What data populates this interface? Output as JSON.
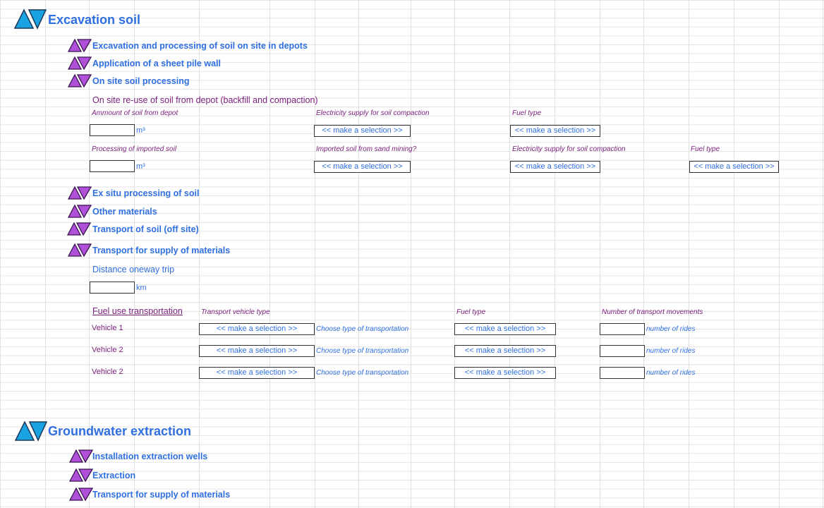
{
  "sections": {
    "excavation": {
      "title": "Excavation soil"
    },
    "groundwater": {
      "title": "Groundwater extraction"
    }
  },
  "excavation_items": {
    "depots": "Excavation and processing of soil on site in depots",
    "sheet_pile": "Application of a sheet pile wall",
    "on_site": "On site soil processing",
    "ex_situ": "Ex situ processing of soil",
    "other": "Other materials",
    "transport_offsite": "Transport of soil (off site)",
    "transport_supply": "Transport for supply of materials"
  },
  "reuse": {
    "heading": "On site re-use of soil from depot (backfill and compaction)",
    "amount_label": "Ammount of soil from depot",
    "electricity_label": "Electricity supply for soil compaction",
    "fuel_label": "Fuel type",
    "processing_label": "Processing of imported soil",
    "sand_mining_label": "Imported soil from sand mining?",
    "electricity_label_2": "Electricity supply for soil compaction",
    "fuel_label_2": "Fuel type",
    "unit_m3": "m³",
    "select_text": "<< make a selection >>"
  },
  "supply": {
    "distance_label": "Distance oneway trip",
    "unit_km": "km",
    "fuel_use_label": "Fuel use transportation",
    "vehicle_type_header": "Transport vehicle type",
    "fuel_type_header": "Fuel type",
    "movements_header": "Number of transport movements",
    "select_text": "<< make a selection >>",
    "type_hint": "Choose type of transportation",
    "rides_hint": "number of rides",
    "vehicles": [
      "Vehicle 1",
      "Vehicle 2",
      "Vehicle 2"
    ]
  },
  "groundwater_items": {
    "wells": "Installation extraction wells",
    "extraction": "Extraction",
    "transport_supply": "Transport for supply of materials"
  },
  "colors": {
    "title_blue": "#2f6fe0",
    "label_purple": "#7a1e7a",
    "icon_cyan": "#1aa3e0",
    "icon_purple": "#b04fd8"
  },
  "icons": {
    "big": "expand-collapse-cyan-icon",
    "small": "expand-collapse-purple-icon"
  }
}
